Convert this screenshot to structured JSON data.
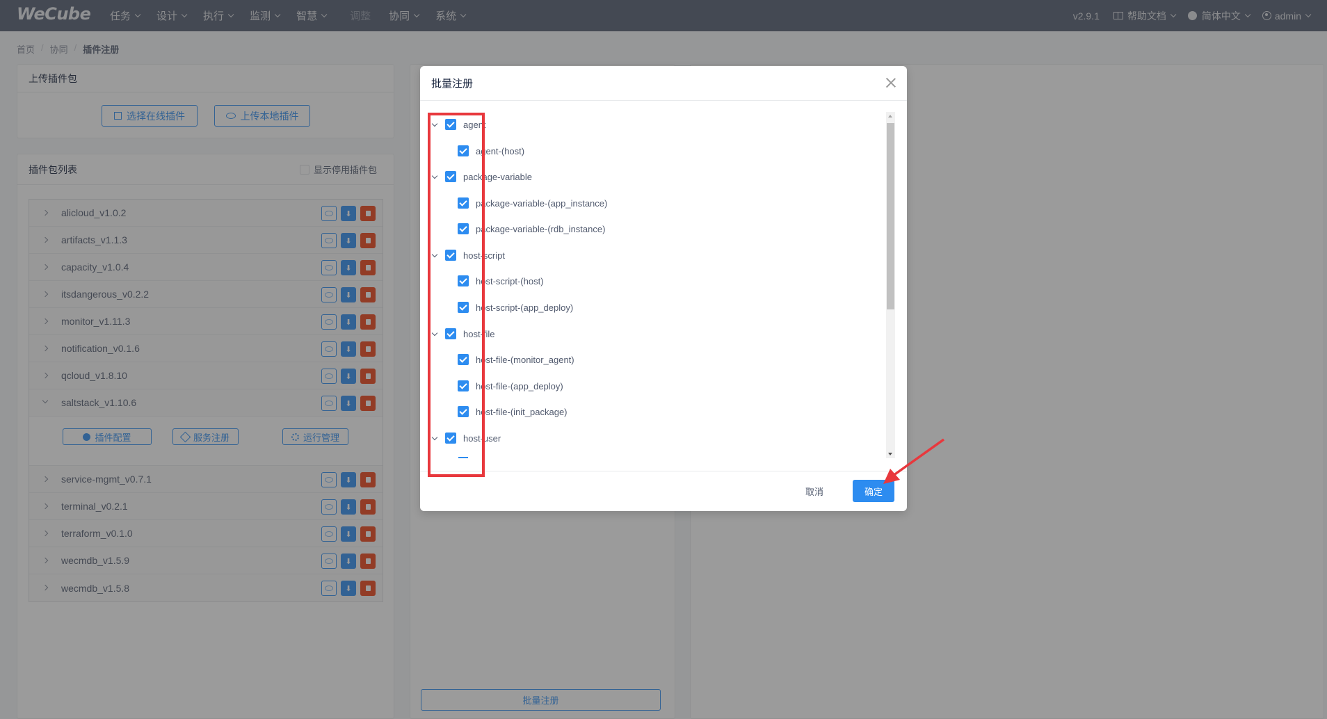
{
  "app": {
    "logo": "WeCube",
    "version": "v2.9.1"
  },
  "nav": {
    "items": [
      {
        "label": "任务"
      },
      {
        "label": "设计"
      },
      {
        "label": "执行"
      },
      {
        "label": "监测"
      },
      {
        "label": "智慧"
      },
      {
        "label": "调整"
      },
      {
        "label": "协同"
      },
      {
        "label": "系统"
      }
    ],
    "help_label": "帮助文档",
    "language_label": "简体中文",
    "user_label": "admin"
  },
  "breadcrumb": {
    "home": "首页",
    "section": "协同",
    "current": "插件注册"
  },
  "upload_panel": {
    "title": "上传插件包",
    "online_button": "选择在线插件",
    "local_button": "上传本地插件"
  },
  "list_panel": {
    "title": "插件包列表",
    "show_disabled_label": "显示停用插件包",
    "plugins": [
      {
        "name": "alicloud_v1.0.2"
      },
      {
        "name": "artifacts_v1.1.3"
      },
      {
        "name": "capacity_v1.0.4"
      },
      {
        "name": "itsdangerous_v0.2.2"
      },
      {
        "name": "monitor_v1.11.3"
      },
      {
        "name": "notification_v0.1.6"
      },
      {
        "name": "qcloud_v1.8.10"
      },
      {
        "name": "saltstack_v1.10.6",
        "expanded": true
      },
      {
        "name": "service-mgmt_v0.7.1"
      },
      {
        "name": "terminal_v0.2.1"
      },
      {
        "name": "terraform_v0.1.0"
      },
      {
        "name": "wecmdb_v1.5.9"
      },
      {
        "name": "wecmdb_v1.5.8"
      }
    ],
    "expanded_actions": {
      "config": "插件配置",
      "service_register": "服务注册",
      "runtime": "运行管理"
    }
  },
  "batch_register_button": "批量注册",
  "modal": {
    "title": "批量注册",
    "tree": [
      {
        "label": "agent",
        "level": 0,
        "checked": true
      },
      {
        "label": "agent-(host)",
        "level": 1,
        "checked": true
      },
      {
        "label": "package-variable",
        "level": 0,
        "checked": true
      },
      {
        "label": "package-variable-(app_instance)",
        "level": 1,
        "checked": true
      },
      {
        "label": "package-variable-(rdb_instance)",
        "level": 1,
        "checked": true
      },
      {
        "label": "host-script",
        "level": 0,
        "checked": true
      },
      {
        "label": "host-script-(host)",
        "level": 1,
        "checked": true
      },
      {
        "label": "host-script-(app_deploy)",
        "level": 1,
        "checked": true
      },
      {
        "label": "host-file",
        "level": 0,
        "checked": true
      },
      {
        "label": "host-file-(monitor_agent)",
        "level": 1,
        "checked": true
      },
      {
        "label": "host-file-(app_deploy)",
        "level": 1,
        "checked": true
      },
      {
        "label": "host-file-(init_package)",
        "level": 1,
        "checked": true
      },
      {
        "label": "host-user",
        "level": 0,
        "checked": true
      }
    ],
    "cancel_label": "取消",
    "ok_label": "确定"
  },
  "colors": {
    "primary": "#2d8cf0",
    "danger": "#ed4014",
    "nav_bg": "#515a6e",
    "highlight": "#e8383d"
  }
}
